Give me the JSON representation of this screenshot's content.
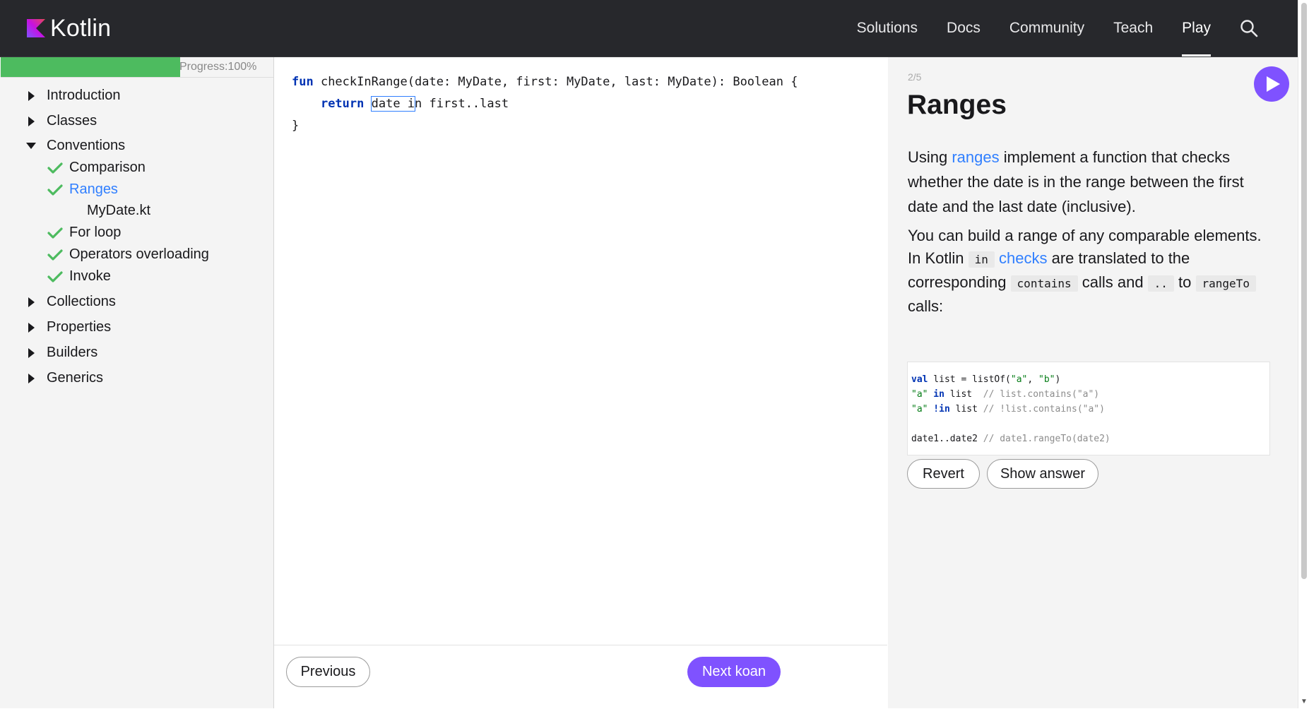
{
  "header": {
    "brand": "Kotlin",
    "nav": [
      "Solutions",
      "Docs",
      "Community",
      "Teach",
      "Play"
    ],
    "active_nav": "Play"
  },
  "sidebar": {
    "progress": {
      "label": "Progress:100%",
      "percent": 100
    },
    "sections": [
      {
        "label": "Introduction",
        "expanded": false
      },
      {
        "label": "Classes",
        "expanded": false
      },
      {
        "label": "Conventions",
        "expanded": true
      },
      {
        "label": "Collections",
        "expanded": false
      },
      {
        "label": "Properties",
        "expanded": false
      },
      {
        "label": "Builders",
        "expanded": false
      },
      {
        "label": "Generics",
        "expanded": false
      }
    ],
    "conventions_items": [
      {
        "label": "Comparison",
        "done": true
      },
      {
        "label": "Ranges",
        "done": true,
        "selected": true
      },
      {
        "label": "MyDate.kt",
        "file": true
      },
      {
        "label": "For loop",
        "done": true
      },
      {
        "label": "Operators overloading",
        "done": true
      },
      {
        "label": "Invoke",
        "done": true
      }
    ]
  },
  "editor": {
    "code": {
      "l1_kw": "fun",
      "l1_rest": " checkInRange(date: MyDate, first: MyDate, last: MyDate): Boolean {",
      "l2_indent": "    ",
      "l2_kw": "return",
      "l2_space": " ",
      "l2_boxed": "date i",
      "l2_rest": "n first..last",
      "l3": "}"
    },
    "previous_label": "Previous",
    "next_label": "Next koan"
  },
  "task": {
    "step": "2/5",
    "title": "Ranges",
    "p1": {
      "t1": "Using ",
      "link": "ranges",
      "t2": " implement a function that checks whether the date is in the range between the first date and the last date (inclusive)."
    },
    "p2": {
      "t1": "You can build a range of any comparable elements. In Kotlin ",
      "code1": "in",
      "link": "checks",
      "t2": " are translated to the corresponding ",
      "code2": "contains",
      "t3": " calls and ",
      "code3": "..",
      "t4": " to ",
      "code4": "rangeTo",
      "t5": " calls:"
    },
    "sample": {
      "l1_kw": "val",
      "l1_a": " list = listOf(",
      "l1_s1": "\"a\"",
      "l1_b": ", ",
      "l1_s2": "\"b\"",
      "l1_c": ")",
      "l2_s": "\"a\"",
      "l2_kw": " in",
      "l2_a": " list  ",
      "l2_com": "// list.contains(\"a\")",
      "l3_s": "\"a\"",
      "l3_kw": " !in",
      "l3_a": " list ",
      "l3_com": "// !list.contains(\"a\")",
      "l5_a": "date1..date2 ",
      "l5_com": "// date1.rangeTo(date2)"
    },
    "revert_label": "Revert",
    "show_answer_label": "Show answer"
  },
  "colors": {
    "accent": "#7f52ff",
    "link": "#307fff",
    "success": "#4dbb5f",
    "header_bg": "#27282c"
  },
  "icons": [
    "kotlin-logo-icon",
    "search-icon",
    "caret-right-icon",
    "caret-down-icon",
    "check-icon",
    "run-icon"
  ]
}
